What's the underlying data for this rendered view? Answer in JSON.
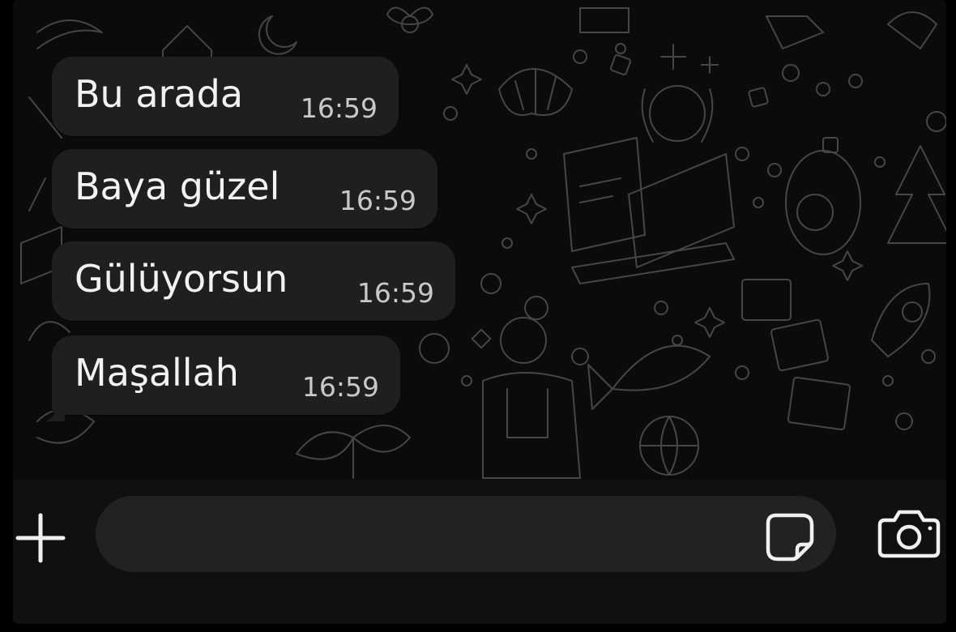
{
  "chat": {
    "messages": [
      {
        "text": "Bu arada",
        "time": "16:59"
      },
      {
        "text": "Baya güzel",
        "time": "16:59"
      },
      {
        "text": "Gülüyorsun",
        "time": "16:59"
      },
      {
        "text": "Maşallah",
        "time": "16:59"
      }
    ]
  },
  "composer": {
    "placeholder": "",
    "value": "",
    "icons": {
      "attach": "plus-icon",
      "sticker": "sticker-icon",
      "camera": "camera-icon"
    }
  },
  "colors": {
    "background": "#0b0b0b",
    "bubble": "#1f1f1f",
    "text": "#f2f2f2",
    "time": "#c9c9c9",
    "composer": "#222222"
  }
}
